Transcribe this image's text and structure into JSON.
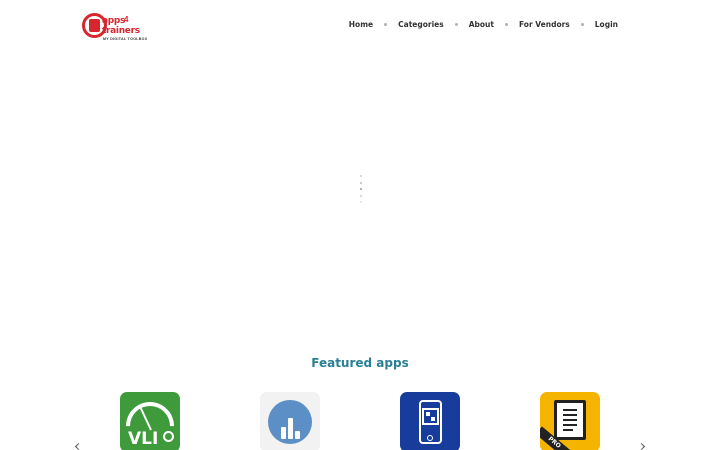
{
  "logo": {
    "line1": "apps",
    "number": "4",
    "line2": "trainers",
    "tagline": "MY DIGITAL TOOLBOX",
    "brand_color": "#d8262e"
  },
  "nav": {
    "items": [
      {
        "label": "Home"
      },
      {
        "label": "Categories"
      },
      {
        "label": "About"
      },
      {
        "label": "For Vendors"
      },
      {
        "label": "Login"
      }
    ]
  },
  "featured": {
    "title": "Featured apps",
    "title_color": "#2a7f97",
    "apps": [
      {
        "icon": "vli-gauge-icon",
        "label": "VLI",
        "color": "#3f9a3b"
      },
      {
        "icon": "bar-chart-icon",
        "color": "#5b8fc6"
      },
      {
        "icon": "qr-phone-icon",
        "color": "#173c9c"
      },
      {
        "icon": "document-pro-icon",
        "badge": "PRO",
        "color": "#f4b400"
      }
    ]
  }
}
